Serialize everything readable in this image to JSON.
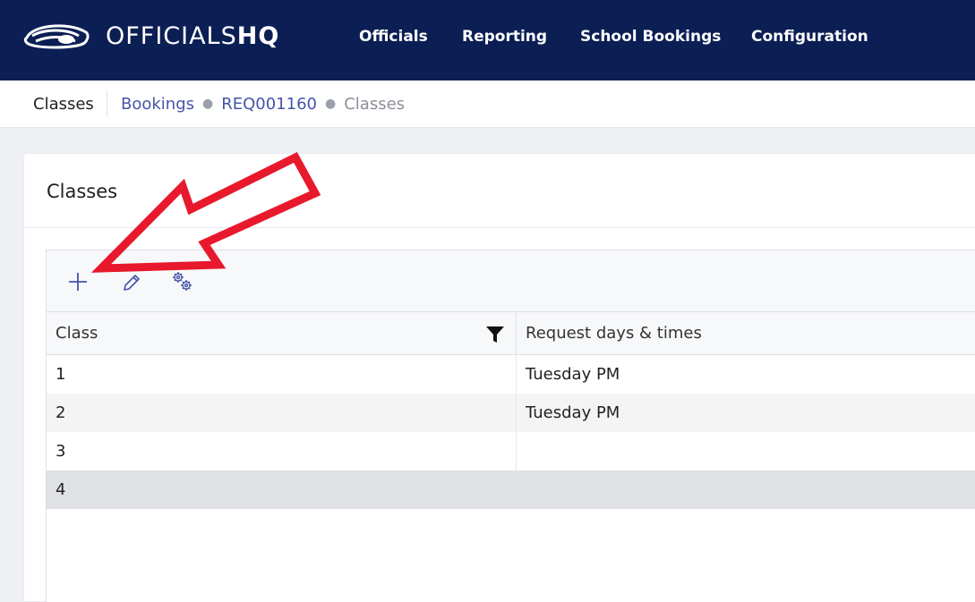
{
  "app": {
    "logo_light": "OFFICIALS",
    "logo_bold": "HQ",
    "brand_color": "#0c1f54"
  },
  "nav": {
    "items": [
      {
        "label": "Officials"
      },
      {
        "label": "Reporting"
      },
      {
        "label": "School Bookings"
      },
      {
        "label": "Configuration"
      }
    ]
  },
  "breadcrumb": {
    "section": "Classes",
    "items": [
      {
        "label": "Bookings"
      },
      {
        "label": "REQ001160"
      }
    ],
    "current": "Classes"
  },
  "card": {
    "title": "Classes"
  },
  "toolbar": {
    "buttons": [
      {
        "icon": "plus-icon"
      },
      {
        "icon": "pencil-icon"
      },
      {
        "icon": "gears-icon"
      }
    ]
  },
  "table": {
    "columns": [
      "Class",
      "Request days & times"
    ],
    "rows": [
      {
        "class": "1",
        "days": "Tuesday PM"
      },
      {
        "class": "2",
        "days": "Tuesday PM"
      },
      {
        "class": "3",
        "days": ""
      },
      {
        "class": "4",
        "days": ""
      }
    ],
    "selected_row": 3
  },
  "annotation": {
    "arrow_color": "#e8192c"
  }
}
